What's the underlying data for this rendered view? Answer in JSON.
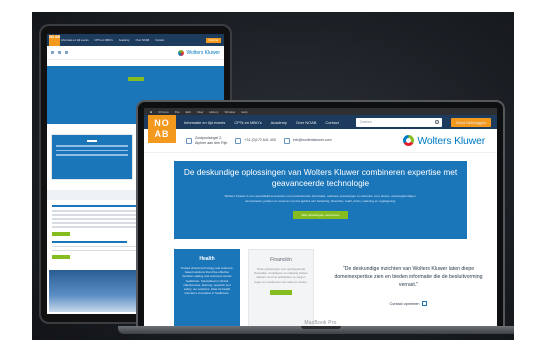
{
  "tablet": {
    "logo": "NO AB",
    "nav": [
      "Informatie en tijd events",
      "CPTs en MBO's",
      "Academy",
      "Over NOAB",
      "Contact"
    ],
    "cta": "Word lid",
    "brand": "Wolters Kluwer"
  },
  "laptop": {
    "menubar": [
      "",
      "Chrome",
      "File",
      "Edit",
      "View",
      "History",
      "Window",
      "Help"
    ],
    "logo_top": "NO",
    "logo_bottom": "AB",
    "nav": {
      "items": [
        "Informatie en tijd events",
        "CPTs en MBO's",
        "Academy",
        "Over NOAB",
        "Contact"
      ],
      "search_placeholder": "Zoeken",
      "cta": "Word lid/inloggen"
    },
    "address": {
      "street": "Zuidpoolsingel 2,",
      "city": "Alphen aan den Rijn",
      "phone": "+31 (0)172 641 400",
      "email": "info@wolterskluwer.com"
    },
    "brand": "Wolters Kluwer",
    "hero": {
      "title": "De deskundige oplossingen van Wolters Kluwer combineren expertise met geavanceerde technologie",
      "body": "Wolters Kluwer is een wereldwijd leverancier van professionele informatie, software oplossingen en diensten voor artsen, verpleegkundigen, accountants, juristen en sectoren op het gebied van belasting, financiën, audit, risico, naleving en regelgeving.",
      "button": "Wat oplossingen verkennen"
    },
    "cards": [
      {
        "title": "Health",
        "body": "Trusted clinical technology and evidence-based solutions that drive effective decision-making and outcomes across healthcare. Specialised in clinical effectiveness, learning, research and safety, our solutions. Data via health insurance innovation in healthcare."
      },
      {
        "title": "Financiën",
        "body": "Onze oplossingen voor geïntegreerde financiële, compliance en naleving helpen klanten met hun activiteiten, te zorgen tegen en voorkomen van risico en fouten."
      }
    ],
    "quote": "\"De deskundige inzichten van Wolters Kluwer laten diepe domeinexpertise zien en bieden informatie die de besluitvorming verrast.\"",
    "contact": "Contact opnemen",
    "model": "MacBook Pro"
  }
}
